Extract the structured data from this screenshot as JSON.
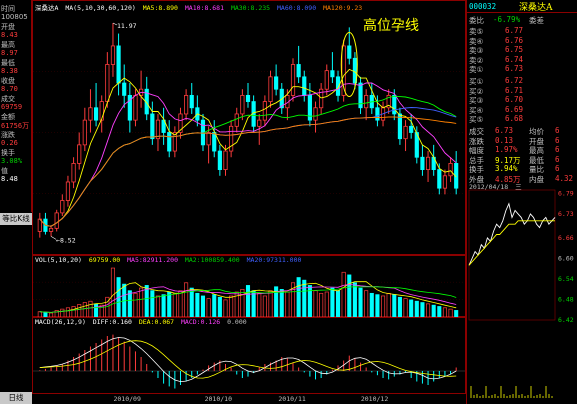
{
  "window": {
    "title": "深桑达A",
    "code": "000032",
    "stock_name": "深桑达A"
  },
  "ma_header": {
    "label": "MA(5,10,30,60,120)",
    "ma5": "MA5:8.890",
    "ma10": "MA10:8.681",
    "ma30": "MA30:8.235",
    "ma60": "MA60:8.090",
    "ma120": "MA120:9.23"
  },
  "left_panel": {
    "items": [
      {
        "label": "时间",
        "value": ""
      },
      {
        "label": "100805",
        "value": ""
      },
      {
        "label": "开盘",
        "value": "8.43"
      },
      {
        "label": "最高",
        "value": "8.97"
      },
      {
        "label": "最低",
        "value": "8.38"
      },
      {
        "label": "收盘",
        "value": "8.70"
      },
      {
        "label": "成交",
        "value": "69759"
      },
      {
        "label": "金额",
        "value": "61756万"
      },
      {
        "label": "涨跌",
        "value": "0.26"
      },
      {
        "label": "换手",
        "value": "3.08%"
      },
      {
        "label": "值",
        "value": "8.48"
      }
    ]
  },
  "annotation": {
    "text": "高位孕线"
  },
  "price_axis": {
    "ticks": [
      "11.97",
      "8.52"
    ]
  },
  "chart_data": [
    {
      "type": "candlestick",
      "title": "",
      "x_tick_labels": [
        "2010/09",
        "2010/10",
        "2010/11",
        "2010/12"
      ],
      "y_tick_labels": [
        "11.97",
        "8.52"
      ],
      "marked_values": {
        "high": 11.97,
        "low": 8.52
      },
      "ohlc": [
        [
          8.6,
          8.9,
          8.5,
          8.8
        ],
        [
          8.8,
          8.9,
          8.55,
          8.6
        ],
        [
          8.6,
          8.7,
          8.52,
          8.65
        ],
        [
          8.65,
          8.95,
          8.6,
          8.9
        ],
        [
          8.9,
          9.2,
          8.85,
          9.1
        ],
        [
          9.1,
          9.5,
          9.0,
          9.4
        ],
        [
          9.4,
          9.8,
          9.3,
          9.7
        ],
        [
          9.7,
          10.2,
          9.6,
          10.0
        ],
        [
          10.0,
          10.6,
          9.9,
          10.4
        ],
        [
          10.4,
          10.9,
          10.2,
          10.6
        ],
        [
          10.6,
          11.0,
          10.3,
          10.4
        ],
        [
          10.4,
          10.8,
          10.2,
          10.7
        ],
        [
          10.7,
          11.5,
          10.6,
          11.3
        ],
        [
          11.3,
          11.97,
          11.1,
          11.6
        ],
        [
          11.6,
          11.8,
          10.8,
          11.0
        ],
        [
          11.0,
          11.3,
          10.6,
          10.8
        ],
        [
          10.8,
          11.0,
          10.2,
          10.4
        ],
        [
          10.4,
          10.9,
          10.3,
          10.8
        ],
        [
          10.8,
          11.2,
          10.6,
          10.9
        ],
        [
          10.9,
          11.1,
          10.4,
          10.5
        ],
        [
          10.5,
          10.7,
          10.0,
          10.1
        ],
        [
          10.1,
          10.5,
          9.9,
          10.4
        ],
        [
          10.4,
          10.6,
          10.0,
          10.2
        ],
        [
          10.2,
          10.4,
          9.8,
          9.9
        ],
        [
          9.9,
          10.3,
          9.8,
          10.2
        ],
        [
          10.2,
          10.6,
          10.1,
          10.5
        ],
        [
          10.5,
          10.9,
          10.4,
          10.8
        ],
        [
          10.8,
          11.0,
          10.5,
          10.6
        ],
        [
          10.6,
          10.8,
          10.3,
          10.4
        ],
        [
          10.4,
          10.5,
          9.9,
          10.0
        ],
        [
          10.0,
          10.3,
          9.7,
          10.2
        ],
        [
          10.2,
          10.4,
          9.8,
          9.9
        ],
        [
          9.9,
          10.0,
          9.5,
          9.6
        ],
        [
          9.6,
          10.0,
          9.5,
          9.9
        ],
        [
          9.9,
          10.4,
          9.8,
          10.3
        ],
        [
          10.3,
          10.6,
          10.2,
          10.5
        ],
        [
          10.5,
          10.9,
          10.4,
          10.8
        ],
        [
          10.8,
          11.0,
          10.6,
          10.7
        ],
        [
          10.7,
          10.8,
          10.2,
          10.3
        ],
        [
          10.3,
          10.5,
          10.0,
          10.4
        ],
        [
          10.4,
          10.8,
          10.3,
          10.7
        ],
        [
          10.7,
          11.2,
          10.6,
          11.1
        ],
        [
          11.1,
          11.3,
          10.8,
          10.9
        ],
        [
          10.9,
          11.0,
          10.5,
          10.6
        ],
        [
          10.6,
          10.9,
          10.4,
          10.8
        ],
        [
          10.8,
          11.4,
          10.7,
          11.3
        ],
        [
          11.3,
          11.6,
          11.0,
          11.1
        ],
        [
          11.1,
          11.2,
          10.7,
          10.8
        ],
        [
          10.8,
          11.0,
          10.3,
          10.4
        ],
        [
          10.4,
          10.7,
          10.2,
          10.6
        ],
        [
          10.6,
          11.0,
          10.5,
          10.9
        ],
        [
          10.9,
          11.3,
          10.8,
          11.2
        ],
        [
          11.2,
          11.5,
          11.0,
          11.1
        ],
        [
          11.1,
          11.2,
          10.7,
          10.8
        ],
        [
          10.8,
          11.7,
          10.7,
          11.6
        ],
        [
          11.6,
          11.9,
          11.3,
          11.4
        ],
        [
          11.4,
          11.5,
          10.9,
          11.0
        ],
        [
          11.0,
          11.1,
          10.5,
          10.6
        ],
        [
          10.6,
          10.9,
          10.4,
          10.8
        ],
        [
          10.8,
          11.0,
          10.5,
          10.6
        ],
        [
          10.6,
          10.8,
          10.3,
          10.4
        ],
        [
          10.4,
          10.7,
          10.3,
          10.6
        ],
        [
          10.6,
          10.9,
          10.5,
          10.8
        ],
        [
          10.8,
          10.9,
          10.4,
          10.5
        ],
        [
          10.5,
          10.6,
          10.0,
          10.1
        ],
        [
          10.1,
          10.4,
          9.9,
          10.3
        ],
        [
          10.3,
          10.5,
          10.1,
          10.2
        ],
        [
          10.2,
          10.3,
          9.7,
          9.8
        ],
        [
          9.8,
          10.0,
          9.5,
          9.6
        ],
        [
          9.6,
          9.9,
          9.4,
          9.8
        ],
        [
          9.8,
          10.0,
          9.5,
          9.6
        ],
        [
          9.6,
          9.7,
          9.2,
          9.3
        ],
        [
          9.3,
          9.6,
          9.2,
          9.5
        ],
        [
          9.5,
          9.8,
          9.4,
          9.7
        ],
        [
          9.7,
          9.9,
          9.2,
          9.3
        ]
      ]
    },
    {
      "type": "bar",
      "title": "VOL(5,10,20)",
      "series": [
        {
          "name": "69759.00",
          "color": "#ffff00"
        },
        {
          "name": "MA5:82911.200",
          "color": "#ff40ff"
        },
        {
          "name": "MA2:100859.400",
          "color": "#00ff00"
        },
        {
          "name": "MA20:97311.000",
          "color": "#4060ff"
        }
      ],
      "y_tick_labels": [
        "372222",
        "279166",
        "186111",
        "93055",
        "0"
      ],
      "values": [
        40,
        35,
        30,
        50,
        60,
        70,
        80,
        95,
        110,
        120,
        100,
        90,
        150,
        372,
        300,
        250,
        200,
        180,
        220,
        240,
        200,
        160,
        170,
        190,
        180,
        200,
        260,
        220,
        180,
        160,
        140,
        170,
        150,
        130,
        160,
        190,
        210,
        240,
        200,
        180,
        160,
        200,
        230,
        210,
        190,
        260,
        300,
        280,
        240,
        200,
        180,
        190,
        220,
        200,
        340,
        320,
        260,
        220,
        200,
        180,
        170,
        160,
        180,
        170,
        150,
        140,
        130,
        120,
        110,
        100,
        90,
        80,
        70,
        60,
        50
      ]
    },
    {
      "type": "bar",
      "title": "MACD(26,12,9)",
      "series": [
        {
          "name": "DIFF:0.160",
          "color": "#ffffff"
        },
        {
          "name": "DEA:0.067",
          "color": "#ffff00"
        },
        {
          "name": "MACD:0.126",
          "color": "#ff40ff"
        },
        {
          "name": "0.000",
          "color": "#c0c0c0"
        }
      ],
      "y_tick_labels": [
        "0.67",
        "0.43",
        "0.20",
        "-0.03",
        "-0.26"
      ],
      "values": [
        0.01,
        0.03,
        0.05,
        0.08,
        0.1,
        0.15,
        0.2,
        0.25,
        0.3,
        0.35,
        0.4,
        0.45,
        0.5,
        0.52,
        0.48,
        0.42,
        0.35,
        0.28,
        0.2,
        0.1,
        -0.02,
        -0.1,
        -0.18,
        -0.22,
        -0.25,
        -0.2,
        -0.15,
        -0.1,
        -0.05,
        0.02,
        0.08,
        0.12,
        0.15,
        0.1,
        0.05,
        -0.05,
        -0.1,
        -0.08,
        -0.03,
        0.05,
        0.1,
        0.12,
        0.15,
        0.2,
        0.18,
        0.12,
        0.05,
        -0.02,
        -0.08,
        -0.12,
        -0.1,
        -0.05,
        0.02,
        0.08,
        0.15,
        0.22,
        0.18,
        0.12,
        0.05,
        -0.02,
        -0.06,
        -0.1,
        -0.12,
        -0.08,
        -0.05,
        -0.02,
        -0.1,
        -0.15,
        -0.18,
        -0.2,
        -0.15,
        -0.1,
        -0.08,
        -0.05,
        0.05
      ]
    },
    {
      "type": "line",
      "title": "2012/04/18",
      "y_tick_labels": [
        "6.79",
        "6.73",
        "6.66",
        "6.60",
        "6.54",
        "6.48",
        "6.42"
      ],
      "y": [
        6.58,
        6.6,
        6.62,
        6.61,
        6.64,
        6.63,
        6.66,
        6.65,
        6.68,
        6.7,
        6.69,
        6.71,
        6.74,
        6.76,
        6.72,
        6.74,
        6.73,
        6.72,
        6.7,
        6.71,
        6.73,
        6.72,
        6.7,
        6.69,
        6.71,
        6.72,
        6.7,
        6.71,
        6.72
      ],
      "avg": [
        6.58,
        6.59,
        6.6,
        6.61,
        6.62,
        6.63,
        6.64,
        6.65,
        6.66,
        6.67,
        6.67,
        6.68,
        6.69,
        6.7,
        6.7,
        6.7,
        6.71,
        6.71,
        6.71,
        6.71,
        6.71,
        6.71,
        6.71,
        6.71,
        6.71,
        6.71,
        6.71,
        6.71,
        6.71
      ]
    }
  ],
  "axes": {
    "vol_ticks": [
      "372222",
      "279166",
      "186111",
      "93055",
      "0"
    ],
    "macd_ticks": [
      "0.67",
      "0.43",
      "0.20",
      "-0.03",
      "-0.26"
    ],
    "dates": [
      "2010/09",
      "2010/10",
      "2010/11",
      "2010/12"
    ]
  },
  "vol_header": {
    "label": "VOL(5,10,20)",
    "vol": "69759.00",
    "ma5": "MA5:82911.200",
    "ma10": "MA2:100859.400",
    "ma20": "MA20:97311.000"
  },
  "macd_header": {
    "label": "MACD(26,12,9)",
    "diff": "DIFF:0.160",
    "dea": "DEA:0.067",
    "macd": "MACD:0.126",
    "zero": "0.000"
  },
  "left_tabs": {
    "top": "等比K线",
    "bottom": "日线"
  },
  "right_panel": {
    "weibi": {
      "label": "委比",
      "value": "-6.79%",
      "label2": "委差",
      "value2": ""
    },
    "sells": [
      {
        "label": "卖⑤",
        "price": "6.77",
        "vol": ""
      },
      {
        "label": "卖④",
        "price": "6.76",
        "vol": ""
      },
      {
        "label": "卖③",
        "price": "6.75",
        "vol": ""
      },
      {
        "label": "卖②",
        "price": "6.74",
        "vol": ""
      },
      {
        "label": "卖①",
        "price": "6.73",
        "vol": ""
      }
    ],
    "buys": [
      {
        "label": "买①",
        "price": "6.72",
        "vol": ""
      },
      {
        "label": "买②",
        "price": "6.71",
        "vol": ""
      },
      {
        "label": "买③",
        "price": "6.70",
        "vol": ""
      },
      {
        "label": "买④",
        "price": "6.69",
        "vol": ""
      },
      {
        "label": "买⑤",
        "price": "6.68",
        "vol": ""
      }
    ],
    "stats": [
      {
        "l1": "成交",
        "v1": "6.73",
        "l2": "均价",
        "v2": "6"
      },
      {
        "l1": "涨跌",
        "v1": "0.13",
        "l2": "开盘",
        "v2": "6"
      },
      {
        "l1": "幅度",
        "v1": "1.97%",
        "l2": "最高",
        "v2": "6"
      },
      {
        "l1": "总手",
        "v1": "9.17万",
        "l2": "最低",
        "v2": "6"
      },
      {
        "l1": "换手",
        "v1": "3.94%",
        "l2": "量比",
        "v2": "6"
      },
      {
        "l1": "外盘",
        "v1": "4.85万",
        "l2": "内盘",
        "v2": "4.32"
      }
    ],
    "intraday_date": "2012/04/18",
    "intraday_day": "三",
    "intraday_ticks": [
      "6.79",
      "6.73",
      "6.66",
      "6.60",
      "6.54",
      "6.48",
      "6.42"
    ]
  },
  "colors": {
    "up": "#ff3c3c",
    "down": "#00ffff",
    "ma5": "#ffff00",
    "ma10": "#ff40ff",
    "ma30": "#00ff00",
    "ma60": "#4060ff",
    "ma120": "#ff8000",
    "annotation": "#ffff00"
  }
}
